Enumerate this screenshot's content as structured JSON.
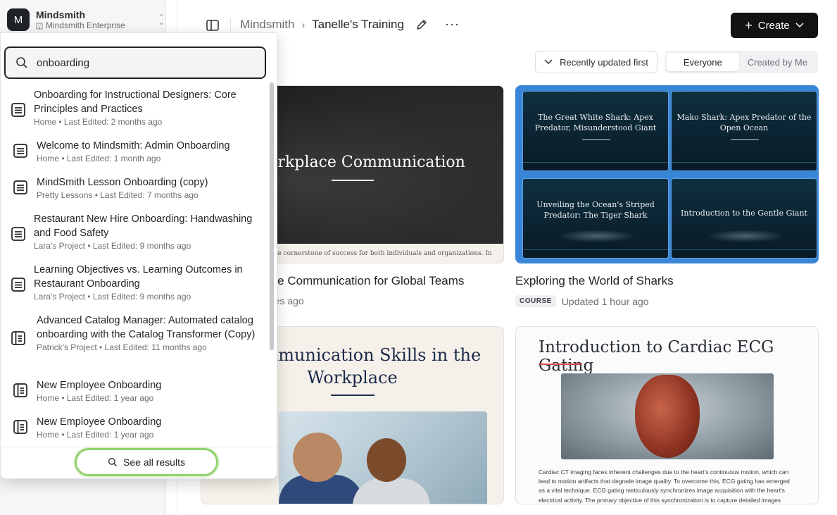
{
  "workspace": {
    "initial": "M",
    "name": "Mindsmith",
    "plan": "Mindsmith Enterprise"
  },
  "breadcrumb": {
    "root": "Mindsmith",
    "current": "Tanelle's Training"
  },
  "toolbar": {
    "create_label": "Create"
  },
  "sort": {
    "selected": "Recently updated first"
  },
  "filter": {
    "options": [
      "Everyone",
      "Created by Me"
    ],
    "active": "Everyone"
  },
  "search": {
    "query": "onboarding",
    "results": [
      {
        "title": "Onboarding for Instructional Designers: Core Principles and Practices",
        "meta": "Home • Last Edited: 2 months ago",
        "icon": "lesson-icon"
      },
      {
        "title": "Welcome to Mindsmith: Admin Onboarding",
        "meta": "Home • Last Edited: 1 month ago",
        "icon": "lesson-icon"
      },
      {
        "title": "MindSmith Lesson Onboarding (copy)",
        "meta": "Pretty Lessons • Last Edited: 7 months ago",
        "icon": "lesson-icon"
      },
      {
        "title": "Restaurant New Hire Onboarding: Handwashing and Food Safety",
        "meta": "Lara's Project • Last Edited: 9 months ago",
        "icon": "lesson-icon"
      },
      {
        "title": "Learning Objectives vs. Learning Outcomes in Restaurant Onboarding",
        "meta": "Lara's Project • Last Edited: 9 months ago",
        "icon": "lesson-icon"
      },
      {
        "title": "Advanced Catalog Manager: Automated catalog onboarding with the Catalog Transformer (Copy)",
        "meta": "Patrick's Project • Last Edited: 11 months ago",
        "icon": "course-icon"
      },
      {
        "title": "New Employee Onboarding",
        "meta": "Home • Last Edited: 1 year ago",
        "icon": "course-icon"
      },
      {
        "title": "New Employee Onboarding",
        "meta": "Home • Last Edited: 1 year ago",
        "icon": "course-icon"
      }
    ],
    "see_all_label": "See all results"
  },
  "cards": [
    {
      "title": "Workplace Communication for Global Teams",
      "visible_title": "place Communication for Global Teams",
      "updated": "utes ago",
      "thumb_heading": "e Workplace Communication",
      "thumb_strip": "n is the cornerstone of success for both individuals and organizations. In"
    },
    {
      "title": "Exploring the World of Sharks",
      "badge": "COURSE",
      "updated": "Updated 1 hour ago",
      "slides": [
        "The Great White Shark: Apex Predator, Misunderstood Giant",
        "Mako Shark: Apex Predator of the Open Ocean",
        "Unveiling the Ocean's Striped Predator: The Tiger Shark",
        "Introduction to the Gentle Giant"
      ]
    },
    {
      "thumb_heading": "e Communication Skills in the Workplace"
    },
    {
      "thumb_heading": "Introduction to Cardiac ECG Gating",
      "thumb_body": "Cardiac CT imaging faces inherent challenges due to the heart's continuous motion, which can lead to motion artifacts that degrade image quality. To overcome this, ECG gating has emerged as a vital technique. ECG gating meticulously synchronizes image acquisition with the heart's electrical activity. The primary objective of this synchronization is to capture detailed images"
    }
  ],
  "colors": {
    "accent_dark": "#111214",
    "see_all_ring": "#8fd36a",
    "shark_card_border": "#3a86d6",
    "ecg_underline": "#d94b4b"
  }
}
